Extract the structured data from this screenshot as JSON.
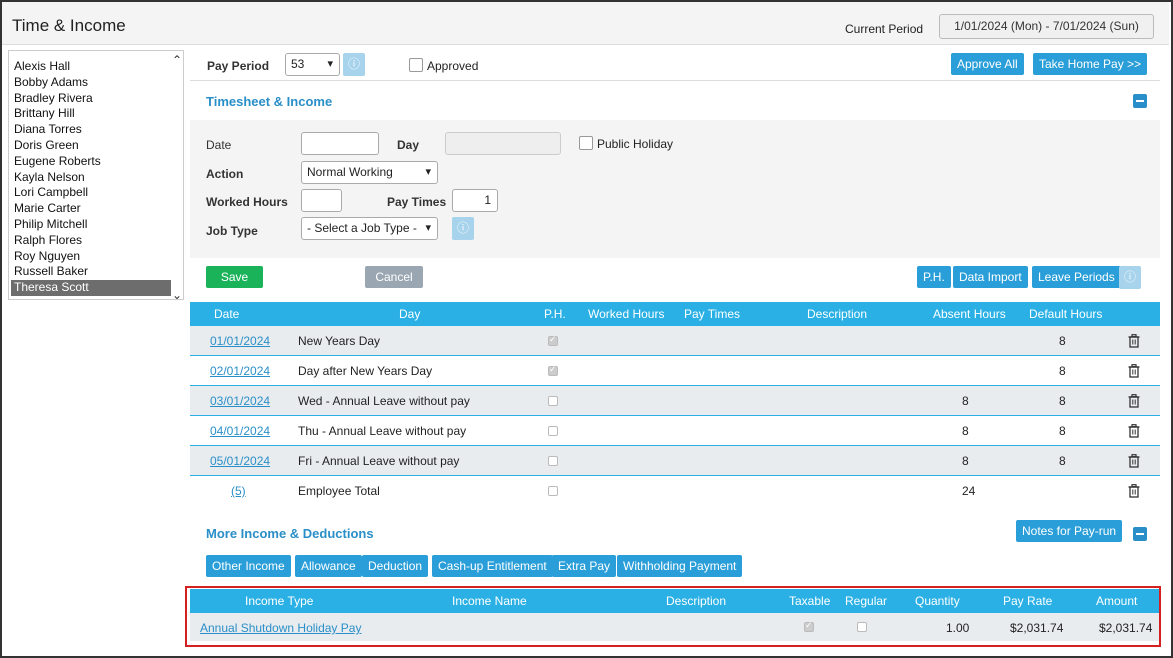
{
  "app": {
    "title": "Time & Income",
    "current_period_label": "Current Period",
    "current_period_value": "1/01/2024 (Mon) - 7/01/2024 (Sun)"
  },
  "employees": [
    {
      "name": "Alexis Hall",
      "selected": false
    },
    {
      "name": "Bobby Adams",
      "selected": false
    },
    {
      "name": "Bradley Rivera",
      "selected": false
    },
    {
      "name": "Brittany Hill",
      "selected": false
    },
    {
      "name": "Diana Torres",
      "selected": false
    },
    {
      "name": "Doris Green",
      "selected": false
    },
    {
      "name": "Eugene Roberts",
      "selected": false
    },
    {
      "name": "Kayla Nelson",
      "selected": false
    },
    {
      "name": "Lori Campbell",
      "selected": false
    },
    {
      "name": "Marie Carter",
      "selected": false
    },
    {
      "name": "Philip Mitchell",
      "selected": false
    },
    {
      "name": "Ralph Flores",
      "selected": false
    },
    {
      "name": "Roy Nguyen",
      "selected": false
    },
    {
      "name": "Russell Baker",
      "selected": false
    },
    {
      "name": "Theresa Scott",
      "selected": true
    }
  ],
  "pay_period": {
    "label": "Pay Period",
    "value": "53",
    "approved_label": "Approved",
    "approved": false,
    "approve_all_label": "Approve All",
    "take_home_label": "Take Home Pay >>"
  },
  "timesheet": {
    "title": "Timesheet & Income",
    "date_label": "Date",
    "date_value": "",
    "day_label": "Day",
    "day_value": "",
    "public_holiday_label": "Public Holiday",
    "action_label": "Action",
    "action_value": "Normal Working",
    "worked_hours_label": "Worked Hours",
    "worked_hours_value": "",
    "pay_times_label": "Pay Times",
    "pay_times_value": "1",
    "job_type_label": "Job Type",
    "job_type_value": "- Select a Job Type -",
    "save_label": "Save",
    "cancel_label": "Cancel",
    "ph_label": "P.H.",
    "data_import_label": "Data Import",
    "leave_periods_label": "Leave Periods"
  },
  "timesheet_table": {
    "headers": [
      "Date",
      "Day",
      "P.H.",
      "Worked Hours",
      "Pay Times",
      "Description",
      "Absent Hours",
      "Default Hours"
    ],
    "rows": [
      {
        "date": "01/01/2024",
        "day": "New Years Day",
        "ph": true,
        "worked": "",
        "pay_times": "",
        "desc": "",
        "absent": "",
        "default": "8"
      },
      {
        "date": "02/01/2024",
        "day": "Day after New Years Day",
        "ph": true,
        "worked": "",
        "pay_times": "",
        "desc": "",
        "absent": "",
        "default": "8"
      },
      {
        "date": "03/01/2024",
        "day": "Wed - Annual Leave without pay",
        "ph": false,
        "worked": "",
        "pay_times": "",
        "desc": "",
        "absent": "8",
        "default": "8"
      },
      {
        "date": "04/01/2024",
        "day": "Thu - Annual Leave without pay",
        "ph": false,
        "worked": "",
        "pay_times": "",
        "desc": "",
        "absent": "8",
        "default": "8"
      },
      {
        "date": "05/01/2024",
        "day": "Fri - Annual Leave without pay",
        "ph": false,
        "worked": "",
        "pay_times": "",
        "desc": "",
        "absent": "8",
        "default": "8"
      }
    ],
    "total": {
      "date": "(5)",
      "day": "Employee Total",
      "absent": "24"
    }
  },
  "more_income": {
    "title": "More Income & Deductions",
    "notes_label": "Notes for Pay-run",
    "buttons": [
      "Other Income",
      "Allowance",
      "Deduction",
      "Cash-up Entitlement",
      "Extra Pay",
      "Withholding Payment"
    ],
    "headers": [
      "Income Type",
      "Income Name",
      "Description",
      "Taxable",
      "Regular",
      "Quantity",
      "Pay Rate",
      "Amount"
    ],
    "rows": [
      {
        "income_type": "Annual Shutdown Holiday Pay",
        "income_name": "",
        "description": "",
        "taxable": true,
        "regular": false,
        "quantity": "1.00",
        "pay_rate": "$2,031.74",
        "amount": "$2,031.74"
      }
    ]
  },
  "colors": {
    "accent": "#2a9ed8",
    "table_header": "#2ab0e4",
    "save_green": "#1ab35a",
    "highlight_red": "#d42020"
  }
}
